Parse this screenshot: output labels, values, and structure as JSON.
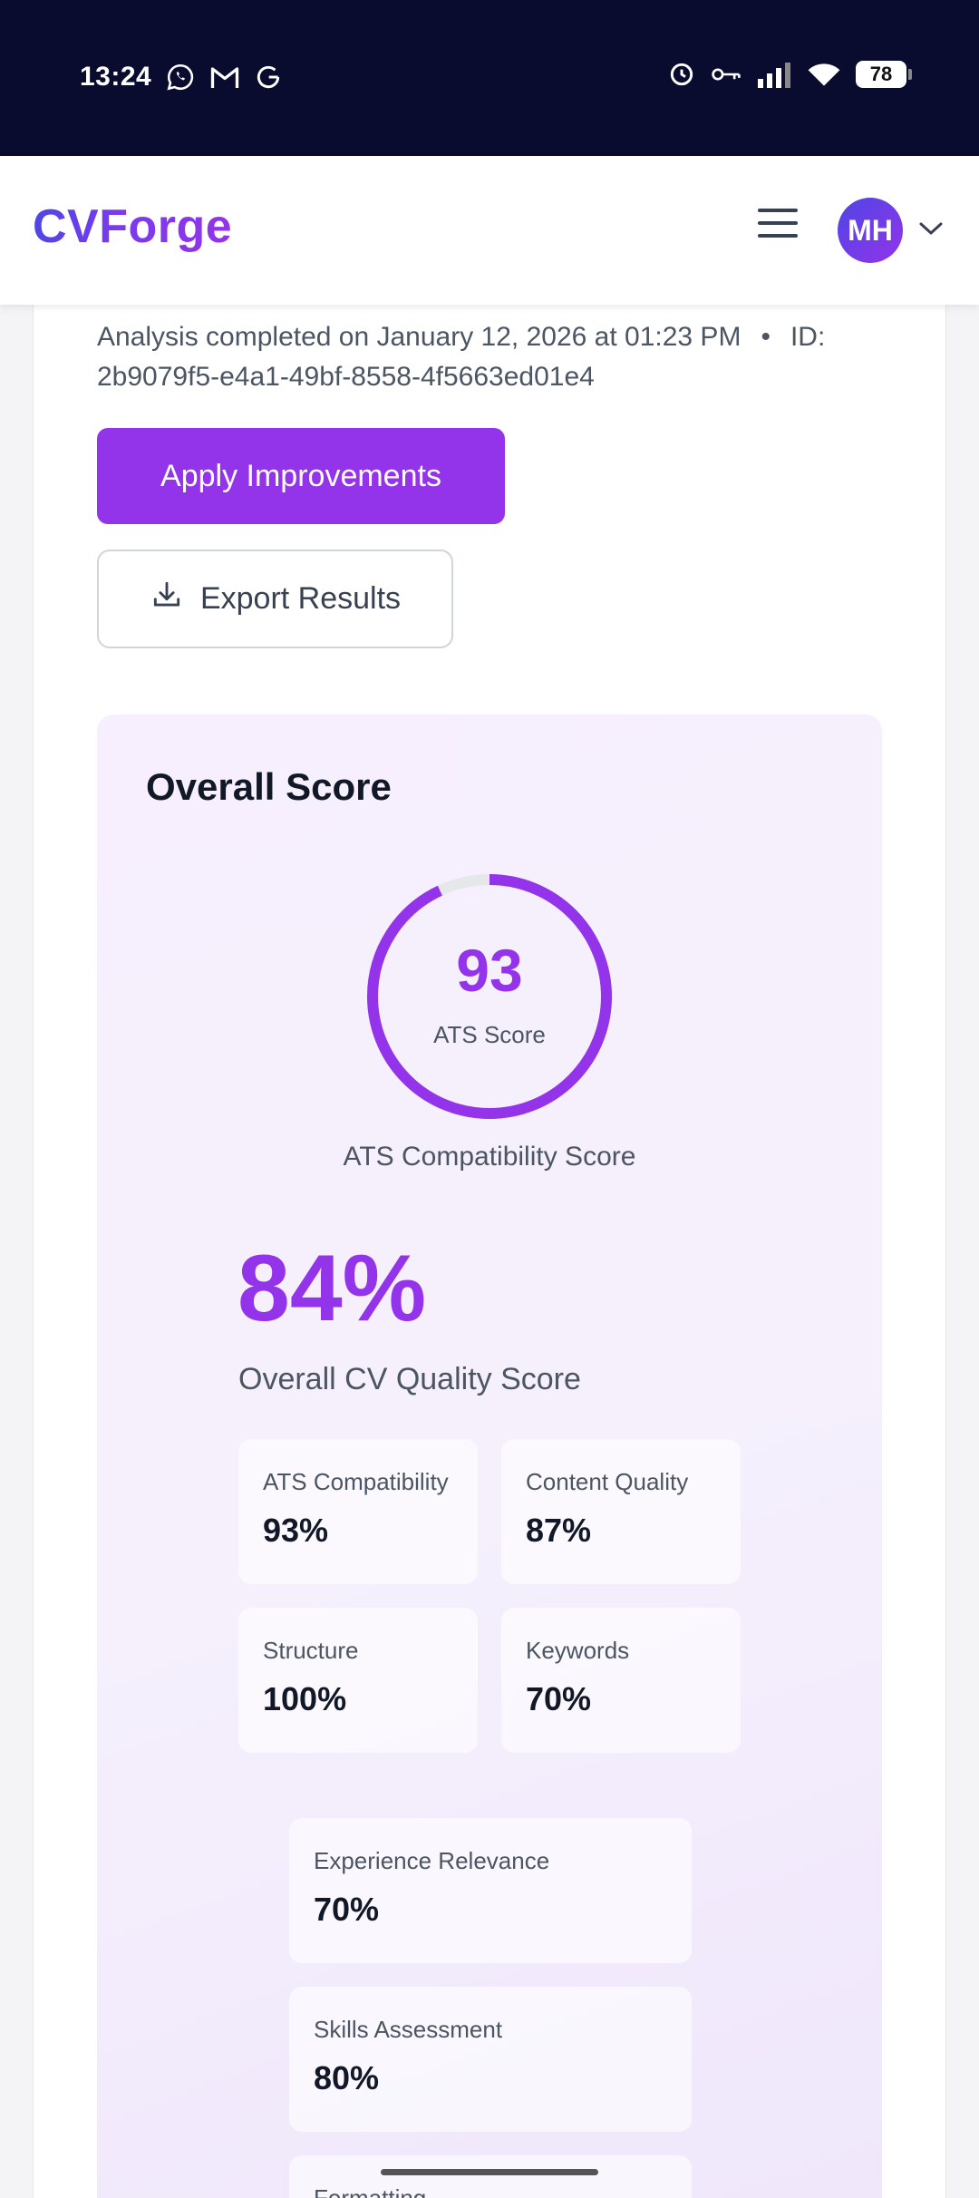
{
  "status_bar": {
    "time": "13:24",
    "battery": "78",
    "icons": [
      "whatsapp-icon",
      "gmail-icon",
      "g-icon",
      "alarm-icon",
      "key-icon",
      "signal-icon",
      "wifi-icon",
      "battery-icon"
    ]
  },
  "header": {
    "logo": "CVForge",
    "avatar_initials": "MH"
  },
  "analysis": {
    "completed_text": "Analysis completed on January 12, 2026 at 01:23 PM",
    "separator": "•",
    "id_text": "ID: 2b9079f5-e4a1-49bf-8558-4f5663ed01e4"
  },
  "actions": {
    "apply_label": "Apply Improvements",
    "export_label": "Export Results"
  },
  "overall": {
    "title": "Overall Score",
    "ats_score": "93",
    "ats_score_value": 93,
    "ats_score_label": "ATS Score",
    "ats_caption": "ATS Compatibility Score",
    "quality_pct": "84%",
    "quality_label": "Overall CV Quality Score",
    "metrics": [
      {
        "label": "ATS Compatibility",
        "value": "93%"
      },
      {
        "label": "Content Quality",
        "value": "87%"
      },
      {
        "label": "Structure",
        "value": "100%"
      },
      {
        "label": "Keywords",
        "value": "70%"
      }
    ],
    "details": [
      {
        "label": "Experience Relevance",
        "value": "70%"
      },
      {
        "label": "Skills Assessment",
        "value": "80%"
      },
      {
        "label": "Formatting",
        "value": ""
      }
    ]
  },
  "colors": {
    "accent": "#9333ea",
    "status_bar": "#090c2e",
    "ring_track": "#e5e7eb"
  }
}
